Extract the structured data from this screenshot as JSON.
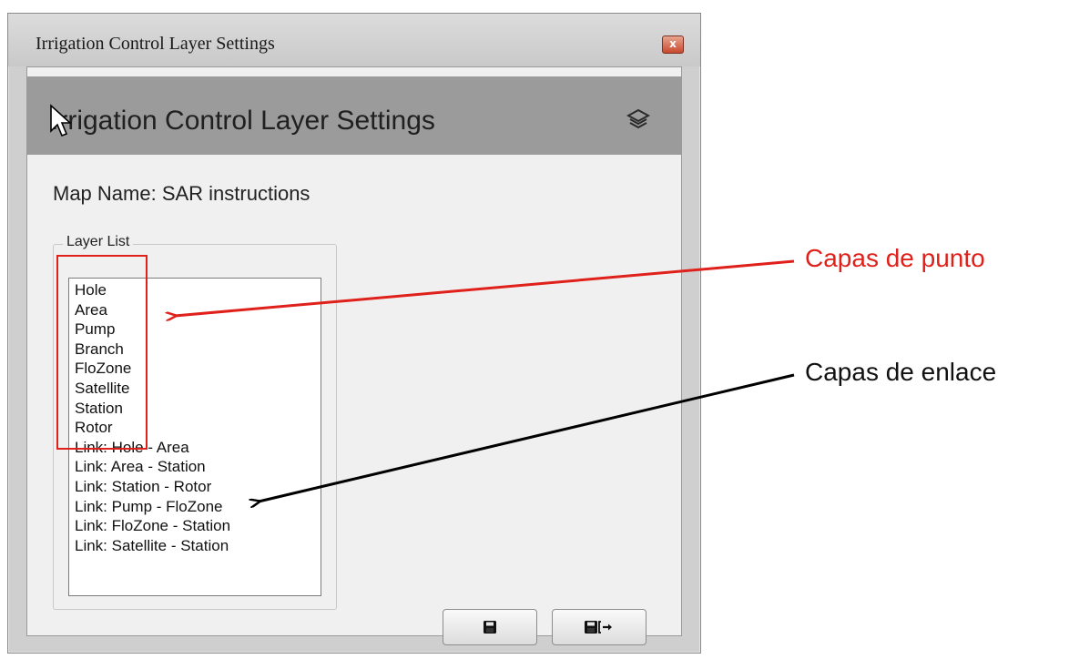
{
  "window": {
    "title": "Irrigation Control Layer Settings",
    "close_glyph": "x"
  },
  "panel": {
    "header_title": "Irrigation Control Layer Settings",
    "map_name": "Map Name:  SAR instructions",
    "layer_group_label": "Layer List",
    "layers": [
      "Hole",
      "Area",
      "Pump",
      "Branch",
      "FloZone",
      "Satellite",
      "Station",
      "Rotor",
      "Link: Hole - Area",
      "Link: Area - Station",
      "Link: Station - Rotor",
      "Link: Pump - FloZone",
      "Link: FloZone - Station",
      "Link: Satellite - Station"
    ],
    "buttons": {
      "save_icon": "save-icon",
      "save_close_icon": "save-and-close-icon"
    }
  },
  "annotations": {
    "point_layers_label": "Capas de punto",
    "link_layers_label": "Capas de enlace",
    "point_color": "#e0201a",
    "link_color": "#000000"
  }
}
